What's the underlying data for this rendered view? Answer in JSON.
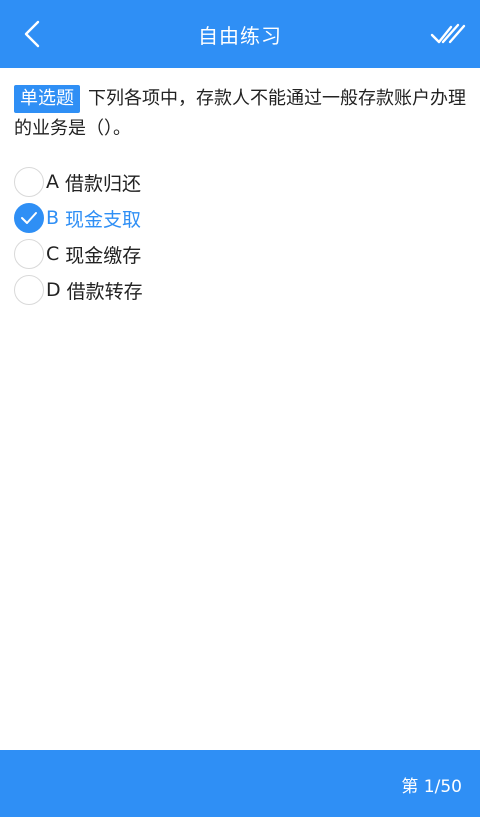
{
  "header": {
    "title": "自由练习",
    "back_icon": "chevron-left-icon",
    "submit_icon": "double-check-icon"
  },
  "question": {
    "type_label": "单选题",
    "text": "下列各项中，存款人不能通过一般存款账户办理的业务是（）。"
  },
  "options": [
    {
      "letter": "A",
      "text": "借款归还",
      "selected": false
    },
    {
      "letter": "B",
      "text": "现金支取",
      "selected": true
    },
    {
      "letter": "C",
      "text": "现金缴存",
      "selected": false
    },
    {
      "letter": "D",
      "text": "借款转存",
      "selected": false
    }
  ],
  "footer": {
    "progress": "第 1/50"
  },
  "colors": {
    "accent": "#2f8ff5",
    "text": "#222222",
    "radio_border": "#d9d9d9"
  }
}
